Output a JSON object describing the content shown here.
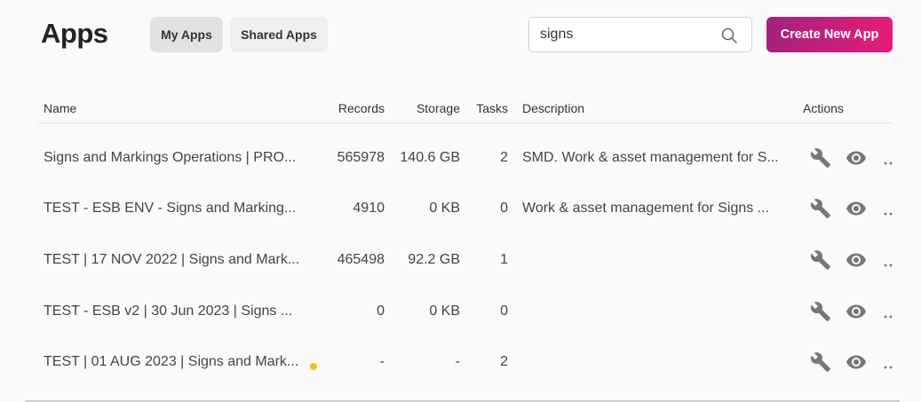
{
  "header": {
    "title": "Apps",
    "tabs": [
      {
        "label": "My Apps",
        "active": true
      },
      {
        "label": "Shared Apps",
        "active": false
      }
    ],
    "search": {
      "value": "signs",
      "icon": "search-icon"
    },
    "create_label": "Create New App",
    "create_gradient": [
      "#a3237c",
      "#e51c78"
    ]
  },
  "table": {
    "columns": {
      "name": "Name",
      "records": "Records",
      "storage": "Storage",
      "tasks": "Tasks",
      "description": "Description",
      "actions": "Actions"
    },
    "rows": [
      {
        "name": "Signs and Markings Operations | PRO...",
        "records": "565978",
        "storage": "140.6 GB",
        "tasks": "2",
        "description": "SMD. Work & asset management for S...",
        "warning": false
      },
      {
        "name": "TEST - ESB ENV - Signs and Marking...",
        "records": "4910",
        "storage": "0 KB",
        "tasks": "0",
        "description": "Work & asset management for Signs ...",
        "warning": false
      },
      {
        "name": "TEST | 17 NOV 2022 | Signs and Mark...",
        "records": "465498",
        "storage": "92.2 GB",
        "tasks": "1",
        "description": "",
        "warning": false
      },
      {
        "name": "TEST - ESB v2 | 30 Jun 2023 | Signs ...",
        "records": "0",
        "storage": "0 KB",
        "tasks": "0",
        "description": "",
        "warning": false
      },
      {
        "name": "TEST | 01 AUG 2023 | Signs and Mark...",
        "records": "-",
        "storage": "-",
        "tasks": "2",
        "description": "",
        "warning": true
      }
    ],
    "action_icons": [
      "wrench-icon",
      "eye-icon",
      "more-icon"
    ],
    "warning_color": "#f5bf1c"
  }
}
